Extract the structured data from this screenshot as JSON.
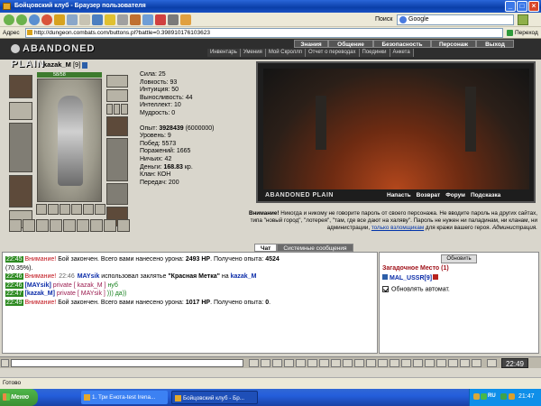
{
  "window": {
    "title": "Бойцовский клуб - Браузер пользователя"
  },
  "search": {
    "label": "Поиск",
    "engine": "Google"
  },
  "address": {
    "label": "Адрес",
    "url": "http://dungeon.combats.com/buttons.pl?battle=0.398910176103623",
    "go_label": "Переход"
  },
  "game": {
    "logo": "ABANDONED PLAIN",
    "nav_main": [
      "Знания",
      "Общение",
      "Безопасность",
      "Персонаж",
      "Выход"
    ],
    "nav_sub": [
      "Инвентарь",
      "Умения",
      "Мой Скроллп",
      "Отчет о переводах",
      "Поединки",
      "Анкета"
    ]
  },
  "character": {
    "name": "kazak_M",
    "level": "[9]",
    "hp_text": "58/58",
    "stats": {
      "strength": "Сила: 25",
      "agility": "Ловкость: 93",
      "intuition": "Интуиция: 50",
      "endurance": "Выносливость: 44",
      "intellect": "Интеллект: 10",
      "wisdom": "Мудрость: 0",
      "experience_label": "Опыт: ",
      "experience_value": "3928439",
      "experience_extra": " (6000000)",
      "level": "Уровень: 9",
      "wins": "Побед: 5573",
      "losses": "Поражений: 1665",
      "draws": "Ничьих: 42",
      "money_label": "Деньги: ",
      "money_value": "168.83",
      "money_unit": " кр.",
      "clan": "Клан: КОН",
      "transfers": "Передач: 200"
    }
  },
  "scene": {
    "logo": "ABANDONED PLAIN",
    "links": [
      "Напасть",
      "Возврат",
      "Форум",
      "Подсказка"
    ]
  },
  "warning": {
    "prefix": "Внимание!",
    "text": " Никогда и никому не говорите пароль от своего персонажа. Не вводите пароль на других сайтах, типа \"новый город\", \"лотерея\", \"там, где все дают на халяву\". Пароль не нужен ни паладинам, ни кланам, ни администрации, ",
    "link": "только взломщикам",
    "text2": " для кражи вашего героя.",
    "signature": "Администрация."
  },
  "chat": {
    "tabs": {
      "chat": "Чат",
      "system": "Системные сообщения"
    },
    "lines": [
      {
        "time": "22:45",
        "prefix": "Внимание!",
        "text": " Бой закончен. Всего вами нанесено урона: ",
        "damage": "2493 HP",
        "text2": ". Получено опыта: ",
        "exp": "4524",
        "tail": "(70.35%)."
      },
      {
        "time": "22:46",
        "prefix": "Внимание!",
        "time2": "22:46",
        "nick": "MAYsik",
        "text": " использовал заклятье ",
        "spell": "\"Красная Метка\"",
        "on": " на ",
        "target": "kazak_M"
      },
      {
        "time": "22:46",
        "nick": "[MAYsik]",
        "private": " private [ kazak_M ]",
        "msg": " нуб"
      },
      {
        "time": "22:47",
        "nick": "[kazak_M]",
        "private": " private [ MAYsik ]",
        "msg": " ))) да))"
      },
      {
        "time": "22:49",
        "prefix": "Внимание!",
        "text": " Бой закончен. Всего вами нанесено урона: ",
        "damage": "1017 HP",
        "text2": ". Получено опыта: ",
        "exp": "0",
        "tail": "."
      }
    ]
  },
  "room": {
    "refresh": "Обновить",
    "title": "Загадочное Место (1)",
    "user": "MAL_USSR[9]",
    "auto": "Обновлять автомат."
  },
  "chatbar": {
    "time": "22:49"
  },
  "status": {
    "text": "Готово"
  },
  "taskbar": {
    "start": "Меню",
    "tasks": [
      "1. Три Енота-test Irena...",
      "Бойцовский клуб - Бр..."
    ],
    "lang": "RU",
    "time": "21:47"
  }
}
